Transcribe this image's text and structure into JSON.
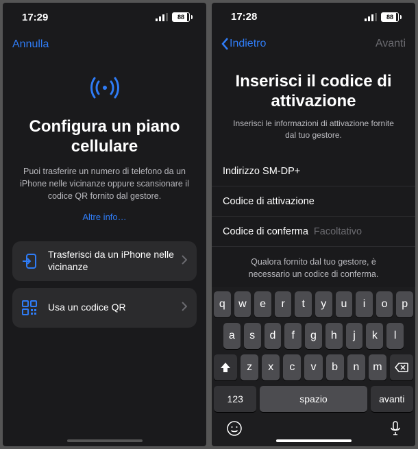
{
  "left": {
    "status": {
      "time": "17:29",
      "battery": "88"
    },
    "nav_cancel": "Annulla",
    "title": "Configura un piano cellulare",
    "subtitle": "Puoi trasferire un numero di telefono da un iPhone nelle vicinanze oppure scansionare il codice QR fornito dal gestore.",
    "more": "Altre info…",
    "options": {
      "transfer": "Trasferisci da un iPhone nelle vicinanze",
      "qr": "Usa un codice QR"
    }
  },
  "right": {
    "status": {
      "time": "17:28",
      "battery": "88"
    },
    "nav_back": "Indietro",
    "nav_next": "Avanti",
    "title": "Inserisci il codice di attivazione",
    "subtitle": "Inserisci le informazioni di attivazione fornite dal tuo gestore.",
    "fields": {
      "smdp": "Indirizzo SM-DP+",
      "activation": "Codice di attivazione",
      "confirm": "Codice di conferma",
      "confirm_ph": "Facoltativo"
    },
    "note": "Qualora fornito dal tuo gestore, è necessario un codice di conferma.",
    "keyboard": {
      "r1": [
        "q",
        "w",
        "e",
        "r",
        "t",
        "y",
        "u",
        "i",
        "o",
        "p"
      ],
      "r2": [
        "a",
        "s",
        "d",
        "f",
        "g",
        "h",
        "j",
        "k",
        "l"
      ],
      "r3": [
        "z",
        "x",
        "c",
        "v",
        "b",
        "n",
        "m"
      ],
      "num": "123",
      "space": "spazio",
      "done": "avanti"
    }
  }
}
